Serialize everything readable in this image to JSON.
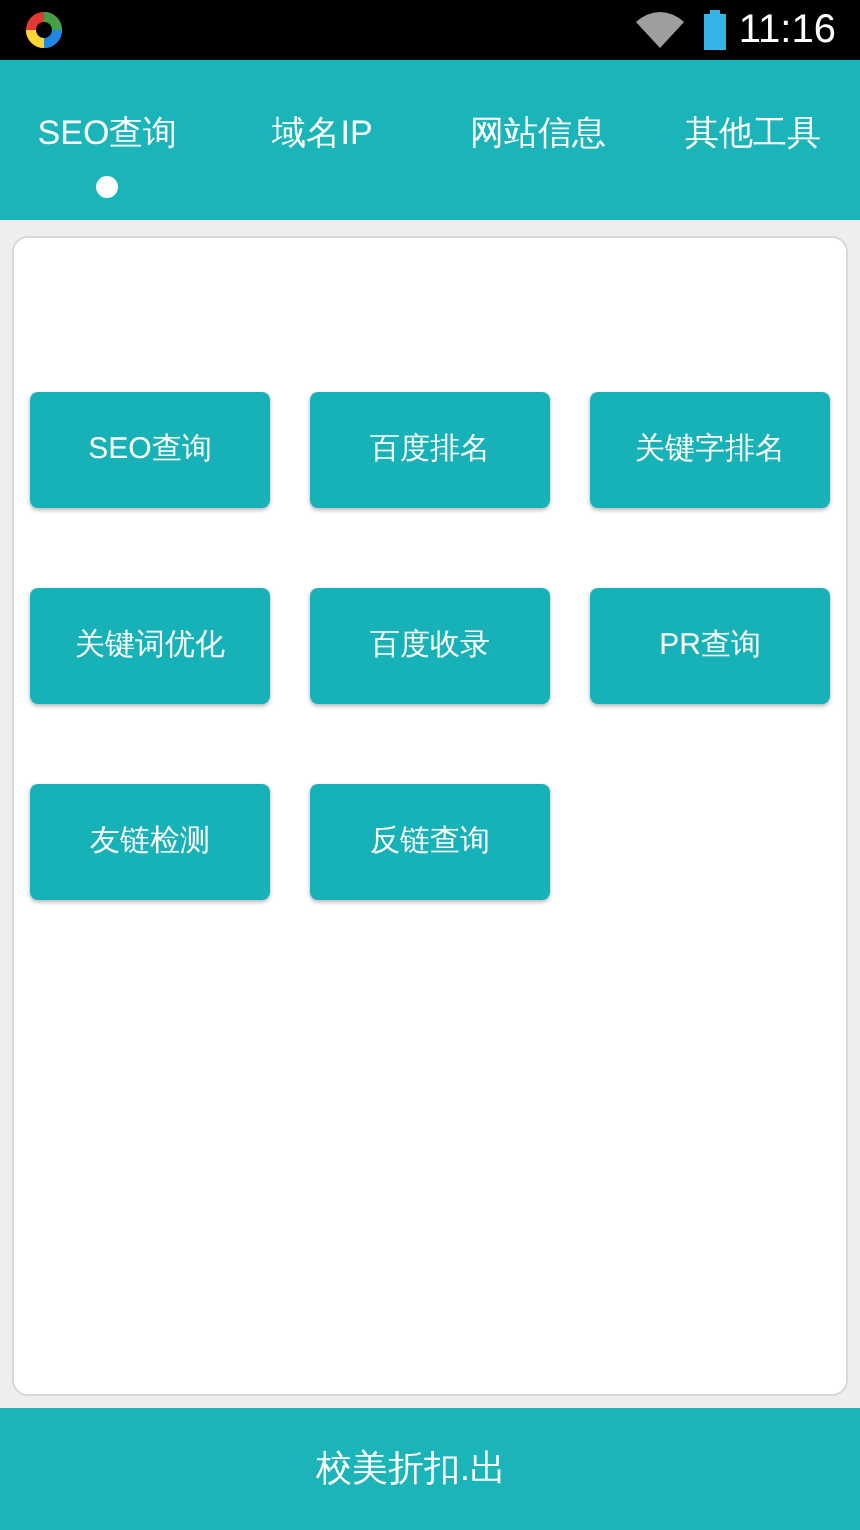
{
  "status_bar": {
    "time": "11:16"
  },
  "tabs": [
    {
      "label": "SEO查询",
      "selected": true
    },
    {
      "label": "域名IP",
      "selected": false
    },
    {
      "label": "网站信息",
      "selected": false
    },
    {
      "label": "其他工具",
      "selected": false
    }
  ],
  "tools": [
    "SEO查询",
    "百度排名",
    "关键字排名",
    "关键词优化",
    "百度收录",
    "PR查询",
    "友链检测",
    "反链查询"
  ],
  "footer": {
    "text": "校美折扣.出"
  }
}
